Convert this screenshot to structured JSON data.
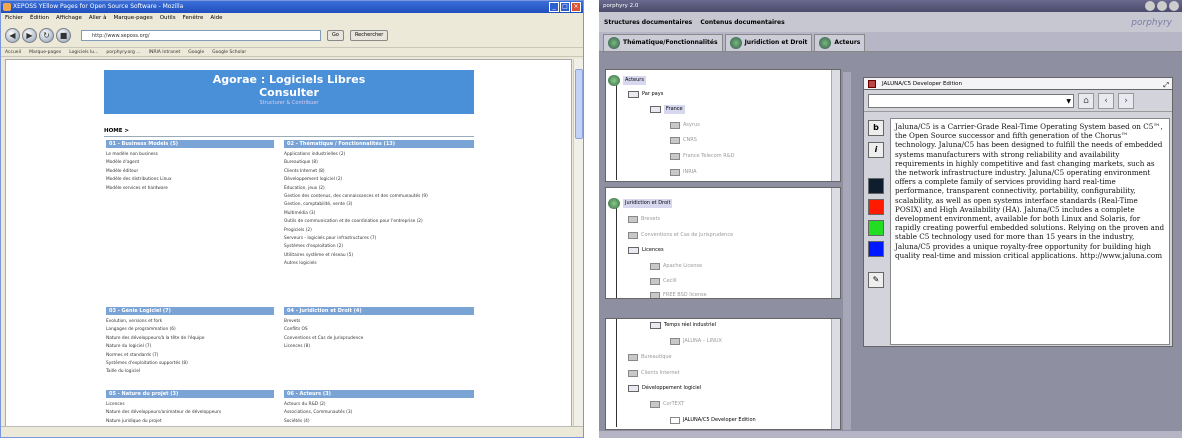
{
  "left_window": {
    "title": "XEPOSS YEllow Pages for Open Source Software - Mozilla",
    "menu": [
      "Fichier",
      "Édition",
      "Affichage",
      "Aller à",
      "Marque-pages",
      "Outils",
      "Fenêtre",
      "Aide"
    ],
    "url": "http://www.xeposs.org/",
    "go_label": "Go",
    "search_label": "Rechercher",
    "bookmarks": [
      "Accueil",
      "Marque-pages",
      "Logiciels lu...",
      "porphyry.org ...",
      "INRIA Intranet",
      "Google",
      "Google Scholar"
    ],
    "banner": {
      "title": "Agorae : Logiciels Libres",
      "subtitle": "Consulter",
      "small": "Structurer & Contribuer"
    },
    "home": "HOME >",
    "sections": [
      {
        "heading": "01 - Business Models (5)",
        "items": [
          "Le modèle non business",
          "Modèle d'agent",
          "Modèle éditeur",
          "Modèle des distributions Linux",
          "Modèle services et hardware"
        ]
      },
      {
        "heading": "02 - Thématique / Fonctionnalités (13)",
        "items": [
          "Applications industrielles (2)",
          "Bureautique (8)",
          "Clients Internet (8)",
          "Développement logiciel (2)",
          "Éducation, jeux (2)",
          "Gestion des contenus, des connaissances et des communautés (9)",
          "Gestion, comptabilité, vente (3)",
          "Multimédia (3)",
          "Outils de communication et de coordination pour l'entreprise (2)",
          "Progiciels (2)",
          "Serveurs - logiciels pour infrastructures (7)",
          "Systèmes d'exploitation (2)",
          "Utilitaires système et réseau (5)",
          "Autres logiciels"
        ]
      },
      {
        "heading": "03 - Génie Logiciel (7)",
        "items": [
          "Évolution, versions et fork",
          "Langages de programmation (6)",
          "Nature des développeurs/à la tête de l'équipe",
          "Nature du logiciel (7)",
          "Normes et standards (7)",
          "Systèmes d'exploitation supportés (8)",
          "Taille du logiciel"
        ]
      },
      {
        "heading": "04 - Juridiction et Droit (4)",
        "items": [
          "Brevets",
          "Conflits OS",
          "Conventions et Cas de Jurisprudence",
          "Licences (8)"
        ]
      },
      {
        "heading": "05 - Nature du projet (3)",
        "items": [
          "Licences",
          "Nature des développeurs/animateur de développeurs",
          "Nature juridique du projet"
        ]
      },
      {
        "heading": "06 - Acteurs (3)",
        "items": [
          "Acteurs du R&D (2)",
          "Associations, Communautés (3)",
          "Sociétés (4)"
        ]
      }
    ]
  },
  "right_window": {
    "title": "porphyry 2.0",
    "logo": "porphyry",
    "menu": [
      "Structures documentaires",
      "Contenus documentaires"
    ],
    "tabs": [
      "Thématique/Fonctionnalités",
      "Juridiction et Droit",
      "Acteurs"
    ],
    "tree1": [
      "Acteurs",
      "Par pays",
      "France",
      "Asyrus",
      "CNRS",
      "France Telecom R&D",
      "INRIA"
    ],
    "tree2": [
      "Juridiction et Droit",
      "Brevets",
      "Conventions et Cas de jurisprudence",
      "Licences",
      "Apache License",
      "Cecill",
      "FREE BSD license"
    ],
    "tree3": [
      "Temps réel industriel",
      "JALUNA – LINUX",
      "Bureautique",
      "Clients Internet",
      "Développement logiciel",
      "CorTEXT",
      "JALUNA/C5 Developer Edition"
    ],
    "panel": {
      "title": "JALUNA/C5 Developer Edition",
      "bold_btn": "b",
      "italic_btn": "i",
      "colors": [
        "#0f1e2e",
        "#ff1a00",
        "#22dd22",
        "#0018ff"
      ],
      "text": "Jaluna/C5 is a Carrier-Grade Real-Time Operating System based on C5™, the Open Source successor and fifth generation of the Chorus™ technology. Jaluna/C5 has been designed to fulfill the needs of embedded systems manufacturers with strong reliability and availability requirements in highly competitive and fast changing markets, such as the network infrastructure industry. Jaluna/C5 operating environment offers a complete family of services providing hard real-time performance, transparent connectivity, portability, configurability, scalability, as well as open systems interface standards (Real-Time POSIX) and High Availability (HA). Jaluna/C5 includes a complete development environment, available for both Linux and Solaris, for rapidly creating powerful embedded solutions. Relying on the proven and stable C5 technology used for more than 15 years in the industry, Jaluna/C5 provides a unique royalty-free opportunity for building high quality real-time and mission critical applications. http://www.jaluna.com"
    }
  }
}
